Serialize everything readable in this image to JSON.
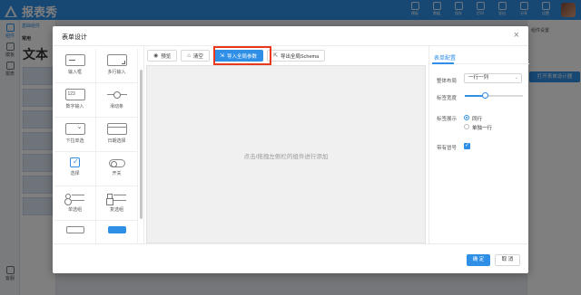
{
  "app": {
    "brand": "报表秀",
    "top_icons": [
      "模板",
      "数据",
      "保存",
      "打印",
      "导出",
      "分享",
      "设置"
    ],
    "left_nav": [
      "组件",
      "模板",
      "报表",
      "客服"
    ],
    "palette_tab": "基础组件",
    "palette_section": "常用",
    "palette_big": "文本",
    "right_button": "打开表单设计器",
    "right_label": "组件设置"
  },
  "modal": {
    "title": "表单设计",
    "close": "×",
    "components": [
      {
        "label": "输入框",
        "icon": "input-icon",
        "cls": "line"
      },
      {
        "label": "多行输入",
        "icon": "textarea-icon",
        "cls": "textarea"
      },
      {
        "label": "数字输入",
        "icon": "number-input-icon",
        "cls": "num"
      },
      {
        "label": "滑动条",
        "icon": "slider-icon",
        "cls": "slider"
      },
      {
        "label": "下拉单选",
        "icon": "select-icon",
        "cls": "select"
      },
      {
        "label": "日期选择",
        "icon": "calendar-icon",
        "cls": "date"
      },
      {
        "label": "选择",
        "icon": "checkbox-icon",
        "cls": "check"
      },
      {
        "label": "开关",
        "icon": "switch-icon",
        "cls": "switch"
      },
      {
        "label": "单选组",
        "icon": "radio-group-icon",
        "cls": "list"
      },
      {
        "label": "复选组",
        "icon": "checkbox-group-icon",
        "cls": "list sq"
      },
      {
        "label": "",
        "icon": "text-icon",
        "cls": "small"
      },
      {
        "label": "",
        "icon": "button-icon",
        "cls": "blue"
      }
    ],
    "toolbar": {
      "preview": "预览",
      "clear": "清空",
      "import": "导入全局参数",
      "export": "导出全局Schema"
    },
    "canvas_placeholder": "点击/拖拽左侧栏的组件进行添加",
    "props": {
      "tab": "表单配置",
      "layout_label": "整体布局",
      "layout_value": "一行一列",
      "label_width_label": "标签宽度",
      "label_width_value": 0.35,
      "label_display_label": "标签展示",
      "label_display_options": [
        "同行",
        "单独一行"
      ],
      "colon_label": "带有冒号",
      "colon_checked": true
    },
    "footer": {
      "ok": "确 定",
      "cancel": "取 消"
    }
  },
  "colors": {
    "accent": "#2f8fe6",
    "highlight": "#e8391e"
  }
}
